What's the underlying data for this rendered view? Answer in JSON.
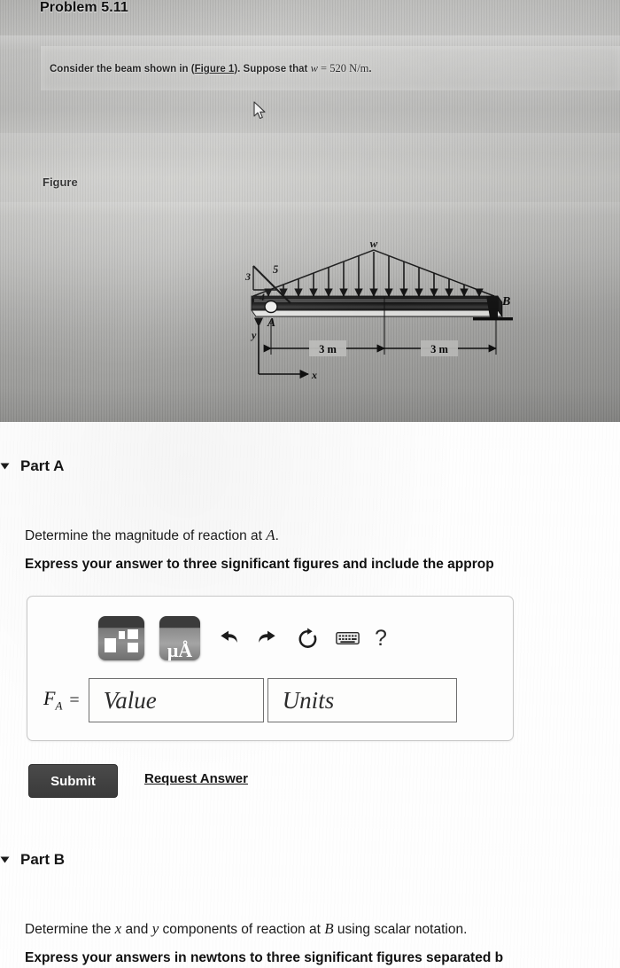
{
  "header": {
    "problem_title": "Problem 5.11"
  },
  "statement": {
    "prefix": "Consider the beam shown in (",
    "figure_link": "Figure 1",
    "middle": "). Suppose that ",
    "variable": "w",
    "equals": " = ",
    "value": "520",
    "units": "N/m",
    "suffix": "."
  },
  "figure": {
    "label": "Figure",
    "load_label": "w",
    "point_a": "A",
    "point_b": "B",
    "slope_rise": "3",
    "slope_run": "4",
    "slope_hyp": "5",
    "axis_x": "x",
    "axis_y": "y",
    "dim_left": "3 m",
    "dim_right": "3 m"
  },
  "part_a": {
    "title": "Part A",
    "prompt_pre": "Determine the magnitude of reaction at ",
    "prompt_var": "A",
    "prompt_post": ".",
    "instruction": "Express your answer to three significant figures and include the approp",
    "toolbar": {
      "template_label": "math-template",
      "units_label": "μÅ",
      "undo_label": "undo",
      "redo_label": "redo",
      "reset_label": "reset",
      "keyboard_label": "keyboard",
      "help_label": "?"
    },
    "field": {
      "symbol": "F",
      "subscript": "A",
      "equals": "=",
      "value_placeholder": "Value",
      "units_placeholder": "Units"
    },
    "submit_label": "Submit",
    "request_answer_label": "Request Answer"
  },
  "part_b": {
    "title": "Part B",
    "prompt_pre": "Determine the ",
    "prompt_var_x": "x",
    "prompt_mid": " and ",
    "prompt_var_y": "y",
    "prompt_post": " components of reaction at ",
    "prompt_var_b": "B",
    "prompt_tail": " using scalar notation.",
    "instruction": "Express your answers in newtons to three significant figures separated b"
  },
  "colors": {
    "page_bg": "#fefefe",
    "photo_panel": "#bdbdbb",
    "text": "#1b1b1b",
    "button_dark": "#3a3a3a",
    "field_border": "#6f6f6f"
  }
}
